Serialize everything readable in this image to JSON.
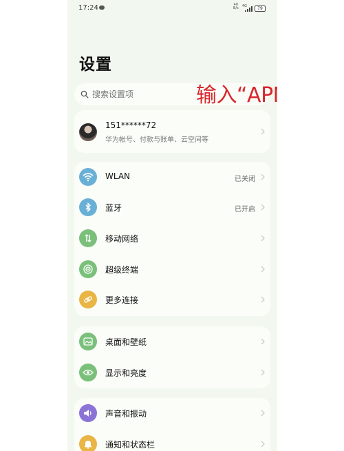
{
  "status_bar": {
    "time": "17:24",
    "net_speed_value": "40",
    "net_speed_unit": "B/s",
    "signal_label": "4G",
    "battery": "79"
  },
  "page": {
    "title": "设置"
  },
  "search": {
    "placeholder": "搜索设置项"
  },
  "overlay": {
    "text": "输入“APN”",
    "color": "#d9262c"
  },
  "account": {
    "name": "151******72",
    "description": "华为帐号、付款与账单、云空间等"
  },
  "connections": [
    {
      "label": "WLAN",
      "value": "已关闭",
      "icon": "wifi-icon",
      "color": "#6ab0d6"
    },
    {
      "label": "蓝牙",
      "value": "已开启",
      "icon": "bluetooth-icon",
      "color": "#6ab0d6"
    },
    {
      "label": "移动网络",
      "value": "",
      "icon": "mobile-network-icon",
      "color": "#7ac07a"
    },
    {
      "label": "超级终端",
      "value": "",
      "icon": "super-device-icon",
      "color": "#7ac07a"
    },
    {
      "label": "更多连接",
      "value": "",
      "icon": "link-icon",
      "color": "#e9b545"
    }
  ],
  "display": [
    {
      "label": "桌面和壁纸",
      "icon": "wallpaper-icon",
      "color": "#7ac07a"
    },
    {
      "label": "显示和亮度",
      "icon": "eye-icon",
      "color": "#7ac07a"
    }
  ],
  "sound": [
    {
      "label": "声音和振动",
      "icon": "speaker-icon",
      "color": "#8b74d6"
    },
    {
      "label": "通知和状态栏",
      "icon": "bell-icon",
      "color": "#e9b545"
    }
  ]
}
